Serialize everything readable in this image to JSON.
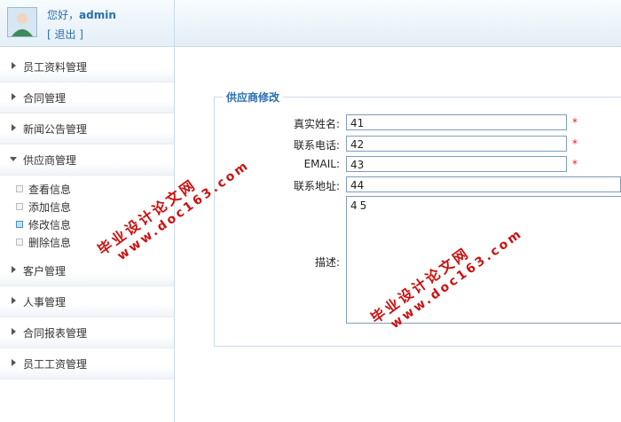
{
  "user": {
    "greeting_prefix": "您好，",
    "username": "admin",
    "logout_label": "[ 退出 ]"
  },
  "nav": {
    "employee_info": "员工资料管理",
    "contract": "合同管理",
    "news": "新闻公告管理",
    "supplier": "供应商管理",
    "supplier_sub": {
      "view": "查看信息",
      "add": "添加信息",
      "edit": "修改信息",
      "delete": "删除信息"
    },
    "customer": "客户管理",
    "hr": "人事管理",
    "contract_report": "合同报表管理",
    "salary": "员工工资管理"
  },
  "form": {
    "legend": "供应商修改",
    "real_name_label": "真实姓名:",
    "real_name_value": "41",
    "phone_label": "联系电话:",
    "phone_value": "42",
    "email_label": "EMAIL:",
    "email_value": "43",
    "address_label": "联系地址:",
    "address_value": "44",
    "desc_label": "描述:",
    "desc_value": "45",
    "required_mark": "*"
  },
  "watermark": {
    "line1": "毕业设计论文网",
    "line2": "www.doc163.com"
  },
  "colors": {
    "accent": "#2a6fb0",
    "required": "#e02020",
    "watermark": "#cc1111"
  }
}
